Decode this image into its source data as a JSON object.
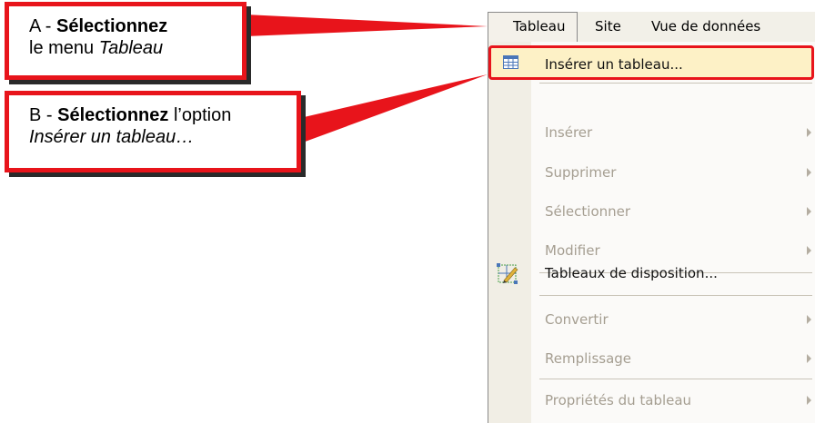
{
  "callout_a": {
    "prefix": "A - ",
    "bold": "Sélectionnez",
    "text": "le menu ",
    "italic": "Tableau"
  },
  "callout_b": {
    "prefix": "B - ",
    "bold": "Sélectionnez",
    "text": " l’option",
    "italic": "Insérer un tableau…"
  },
  "menubar": {
    "tableau": "Tableau",
    "site": "Site",
    "vue": "Vue de données"
  },
  "menu": {
    "items": [
      {
        "label": "Insérer un tableau...",
        "icon": "table-icon"
      },
      {
        "label": "Insérer"
      },
      {
        "label": "Supprimer"
      },
      {
        "label": "Sélectionner"
      },
      {
        "label": "Modifier"
      },
      {
        "label": "Tableaux de disposition...",
        "icon": "layout-table-icon"
      },
      {
        "label": "Convertir"
      },
      {
        "label": "Remplissage"
      },
      {
        "label": "Propriétés du tableau"
      }
    ]
  },
  "colors": {
    "highlight_border": "#e8141b",
    "highlight_fill": "#fdf1c6",
    "menu_bg": "#fbfaf8",
    "gutter": "#f1eee5",
    "disabled_text": "#a59e91"
  }
}
